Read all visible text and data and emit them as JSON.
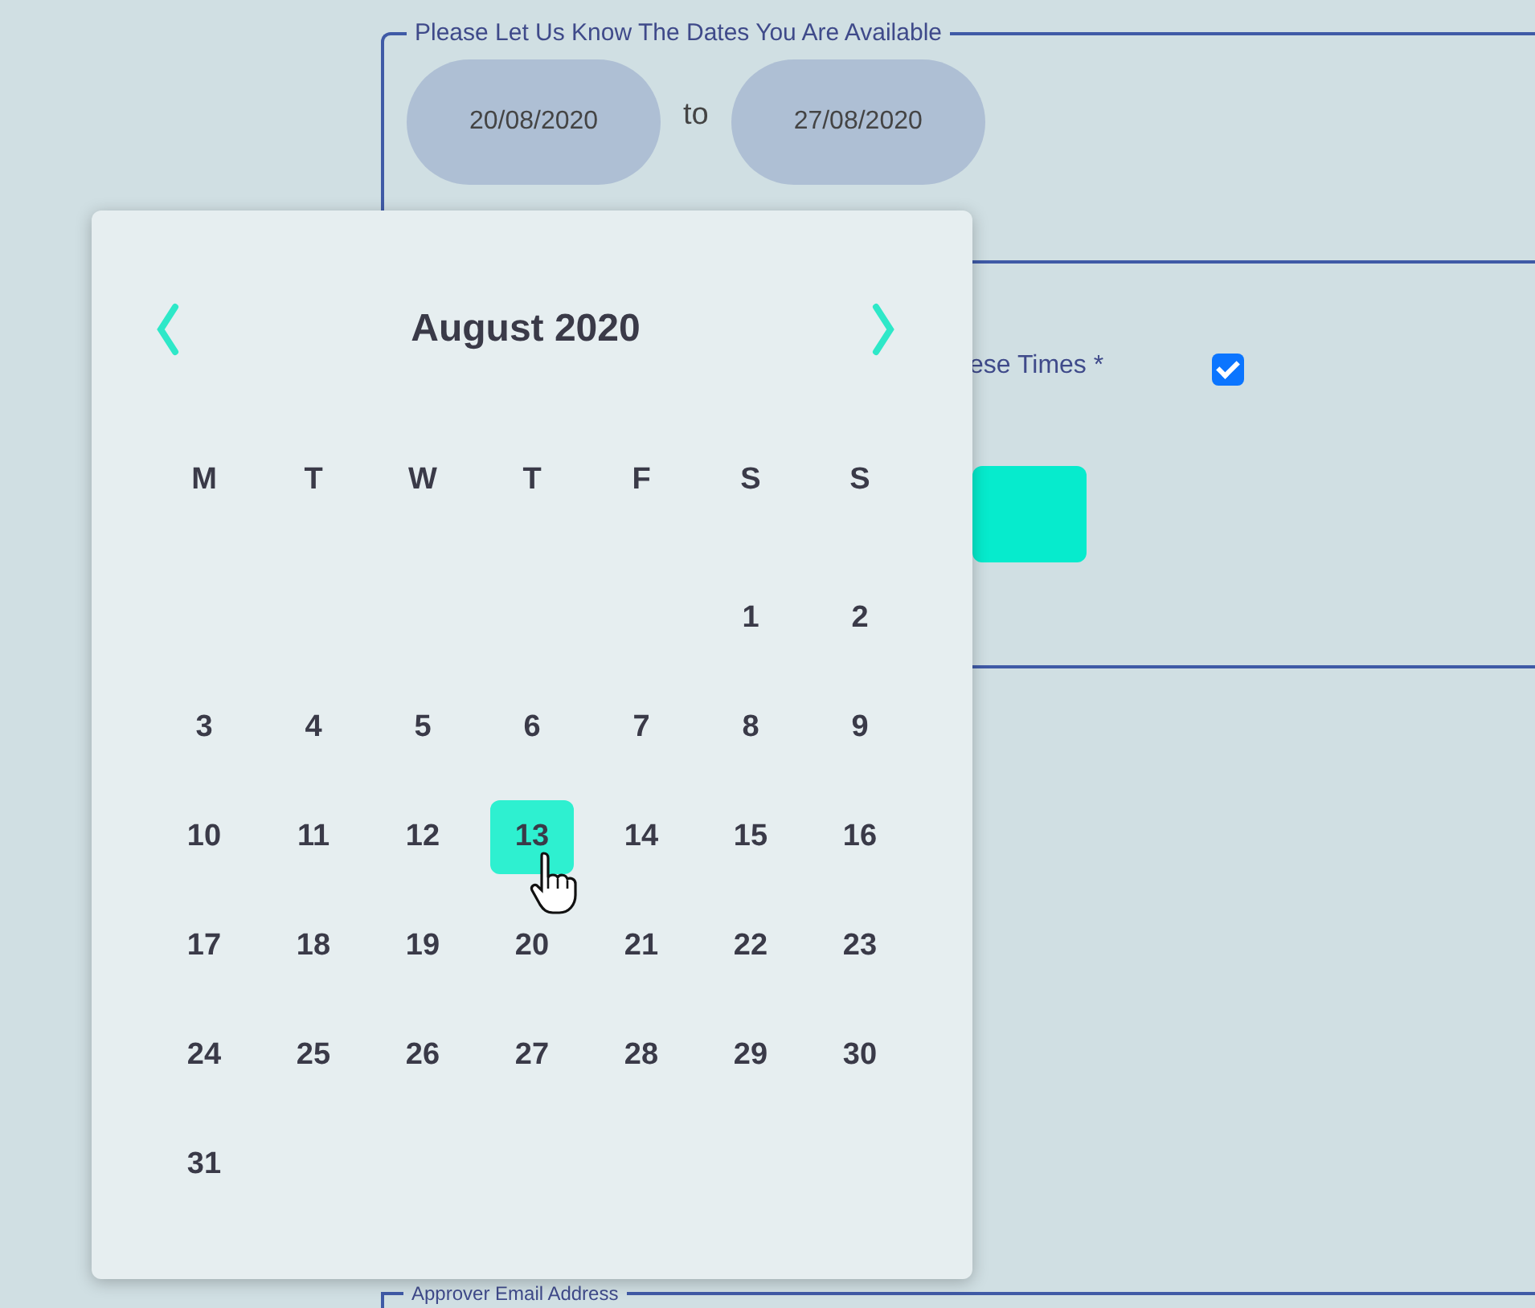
{
  "date_range": {
    "legend": "Please Let Us Know The Dates You Are Available",
    "start": {
      "value": "20/08/2020"
    },
    "separator": "to",
    "end": {
      "value": "27/08/2020"
    }
  },
  "agreement": {
    "label": "ese Times *",
    "checked": true
  },
  "next_section": {
    "legend": "Approver Email Address"
  },
  "datepicker": {
    "title": "August 2020",
    "weekdays": [
      "M",
      "T",
      "W",
      "T",
      "F",
      "S",
      "S"
    ],
    "weeks": [
      [
        {
          "kind": "blank"
        },
        {
          "kind": "blank"
        },
        {
          "kind": "blank"
        },
        {
          "kind": "blank"
        },
        {
          "kind": "blank"
        },
        {
          "kind": "day",
          "label": "1",
          "selected": false
        },
        {
          "kind": "day",
          "label": "2",
          "selected": false
        }
      ],
      [
        {
          "kind": "day",
          "label": "3",
          "selected": false
        },
        {
          "kind": "day",
          "label": "4",
          "selected": false
        },
        {
          "kind": "day",
          "label": "5",
          "selected": false
        },
        {
          "kind": "day",
          "label": "6",
          "selected": false
        },
        {
          "kind": "day",
          "label": "7",
          "selected": false
        },
        {
          "kind": "day",
          "label": "8",
          "selected": false
        },
        {
          "kind": "day",
          "label": "9",
          "selected": false
        }
      ],
      [
        {
          "kind": "day",
          "label": "10",
          "selected": false
        },
        {
          "kind": "day",
          "label": "11",
          "selected": false
        },
        {
          "kind": "day",
          "label": "12",
          "selected": false
        },
        {
          "kind": "day",
          "label": "13",
          "selected": true
        },
        {
          "kind": "day",
          "label": "14",
          "selected": false
        },
        {
          "kind": "day",
          "label": "15",
          "selected": false
        },
        {
          "kind": "day",
          "label": "16",
          "selected": false
        }
      ],
      [
        {
          "kind": "day",
          "label": "17",
          "selected": false
        },
        {
          "kind": "day",
          "label": "18",
          "selected": false
        },
        {
          "kind": "day",
          "label": "19",
          "selected": false
        },
        {
          "kind": "day",
          "label": "20",
          "selected": false
        },
        {
          "kind": "day",
          "label": "21",
          "selected": false
        },
        {
          "kind": "day",
          "label": "22",
          "selected": false
        },
        {
          "kind": "day",
          "label": "23",
          "selected": false
        }
      ],
      [
        {
          "kind": "day",
          "label": "24",
          "selected": false
        },
        {
          "kind": "day",
          "label": "25",
          "selected": false
        },
        {
          "kind": "day",
          "label": "26",
          "selected": false
        },
        {
          "kind": "day",
          "label": "27",
          "selected": false
        },
        {
          "kind": "day",
          "label": "28",
          "selected": false
        },
        {
          "kind": "day",
          "label": "29",
          "selected": false
        },
        {
          "kind": "day",
          "label": "30",
          "selected": false
        }
      ],
      [
        {
          "kind": "day",
          "label": "31",
          "selected": false
        }
      ]
    ]
  }
}
